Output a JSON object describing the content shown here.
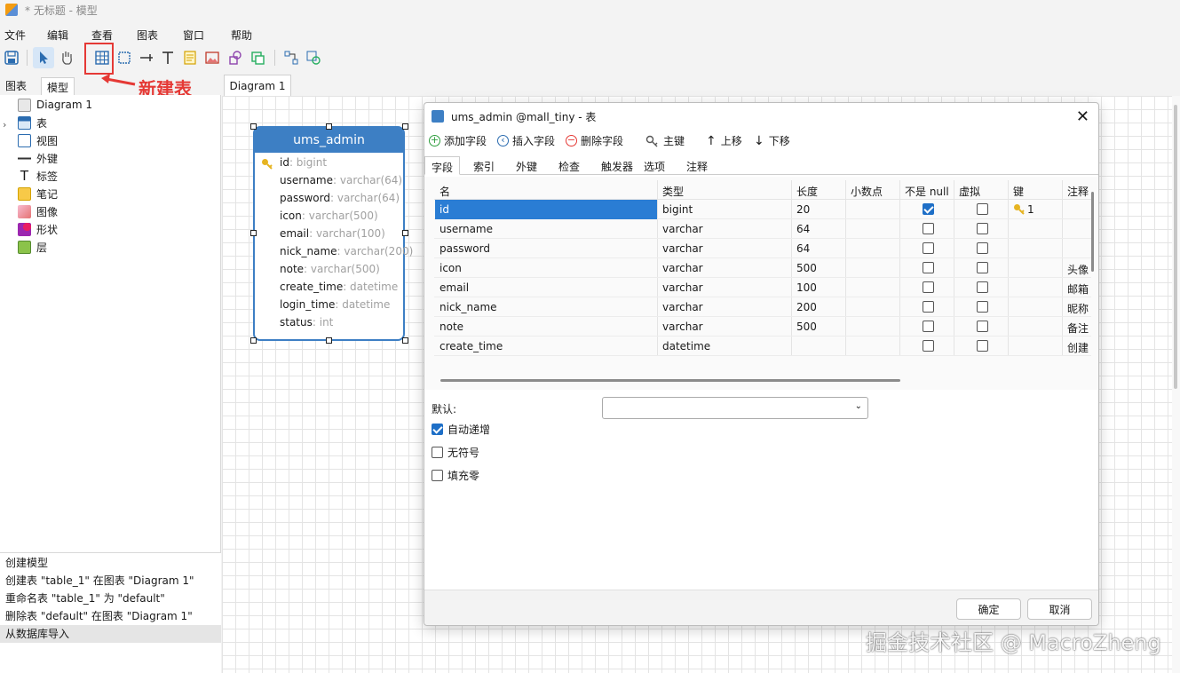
{
  "window": {
    "title": "* 无标题 - 模型"
  },
  "menu": [
    "文件",
    "编辑",
    "查看",
    "图表",
    "窗口",
    "帮助"
  ],
  "annotation": {
    "text": "新建表",
    "color": "#e53935"
  },
  "left_tabs": [
    "图表",
    "模型"
  ],
  "tree": [
    {
      "label": "Diagram 1",
      "icon": "diagram-icon"
    },
    {
      "label": "表",
      "icon": "table-icon"
    },
    {
      "label": "视图",
      "icon": "view-icon"
    },
    {
      "label": "外键",
      "icon": "foreign-key-icon"
    },
    {
      "label": "标签",
      "icon": "label-icon"
    },
    {
      "label": "笔记",
      "icon": "note-icon"
    },
    {
      "label": "图像",
      "icon": "image-icon"
    },
    {
      "label": "形状",
      "icon": "shape-icon"
    },
    {
      "label": "层",
      "icon": "layer-icon"
    }
  ],
  "history": [
    "创建模型",
    "创建表 \"table_1\" 在图表 \"Diagram 1\"",
    "重命名表 \"table_1\" 为 \"default\"",
    "删除表 \"default\" 在图表 \"Diagram 1\"",
    "从数据库导入"
  ],
  "diagram_tab": "Diagram 1",
  "entity": {
    "name": "ums_admin",
    "color": "#3d7fc4",
    "fields": [
      {
        "name": "id",
        "type": ": bigint"
      },
      {
        "name": "username",
        "type": ": varchar(64)"
      },
      {
        "name": "password",
        "type": ": varchar(64)"
      },
      {
        "name": "icon",
        "type": ": varchar(500)"
      },
      {
        "name": "email",
        "type": ": varchar(100)"
      },
      {
        "name": "nick_name",
        "type": ": varchar(200)"
      },
      {
        "name": "note",
        "type": ": varchar(500)"
      },
      {
        "name": "create_time",
        "type": ": datetime"
      },
      {
        "name": "login_time",
        "type": ": datetime"
      },
      {
        "name": "status",
        "type": ": int"
      }
    ]
  },
  "dialog": {
    "title": "ums_admin @mall_tiny - 表",
    "toolbar": {
      "add_field": "添加字段",
      "insert_field": "插入字段",
      "delete_field": "删除字段",
      "primary_key": "主键",
      "move_up": "上移",
      "move_down": "下移"
    },
    "tabs": [
      "字段",
      "索引",
      "外键",
      "检查",
      "触发器",
      "选项",
      "注释"
    ],
    "columns": [
      "名",
      "类型",
      "长度",
      "小数点",
      "不是 null",
      "虚拟",
      "键",
      "注释"
    ],
    "rows": [
      {
        "name": "id",
        "type": "bigint",
        "length": "20",
        "decimals": "",
        "not_null": true,
        "virtual": false,
        "key": "1",
        "comment": ""
      },
      {
        "name": "username",
        "type": "varchar",
        "length": "64",
        "decimals": "",
        "not_null": false,
        "virtual": false,
        "key": "",
        "comment": ""
      },
      {
        "name": "password",
        "type": "varchar",
        "length": "64",
        "decimals": "",
        "not_null": false,
        "virtual": false,
        "key": "",
        "comment": ""
      },
      {
        "name": "icon",
        "type": "varchar",
        "length": "500",
        "decimals": "",
        "not_null": false,
        "virtual": false,
        "key": "",
        "comment": "头像"
      },
      {
        "name": "email",
        "type": "varchar",
        "length": "100",
        "decimals": "",
        "not_null": false,
        "virtual": false,
        "key": "",
        "comment": "邮箱"
      },
      {
        "name": "nick_name",
        "type": "varchar",
        "length": "200",
        "decimals": "",
        "not_null": false,
        "virtual": false,
        "key": "",
        "comment": "昵称"
      },
      {
        "name": "note",
        "type": "varchar",
        "length": "500",
        "decimals": "",
        "not_null": false,
        "virtual": false,
        "key": "",
        "comment": "备注"
      },
      {
        "name": "create_time",
        "type": "datetime",
        "length": "",
        "decimals": "",
        "not_null": false,
        "virtual": false,
        "key": "",
        "comment": "创建"
      }
    ],
    "default_label": "默认:",
    "default_value": "",
    "options": [
      {
        "label": "自动递增",
        "checked": true
      },
      {
        "label": "无符号",
        "checked": false
      },
      {
        "label": "填充零",
        "checked": false
      }
    ],
    "ok": "确定",
    "cancel": "取消"
  },
  "watermark": "掘金技术社区 @ MacroZheng"
}
